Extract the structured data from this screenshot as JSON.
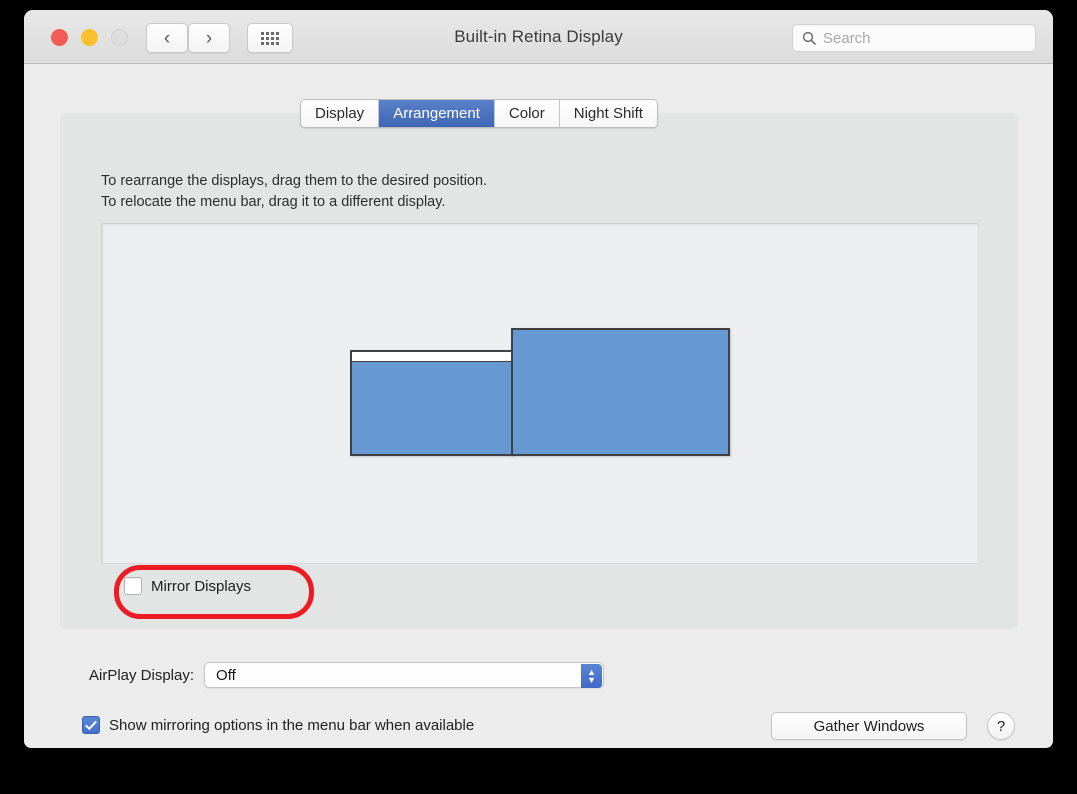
{
  "window": {
    "title": "Built-in Retina Display"
  },
  "toolbar": {
    "back_icon": "chevron-left-icon",
    "forward_icon": "chevron-right-icon",
    "grid_icon": "show-all-grid-icon",
    "search_placeholder": "Search",
    "search_value": ""
  },
  "tabs": [
    {
      "label": "Display",
      "active": false
    },
    {
      "label": "Arrangement",
      "active": true
    },
    {
      "label": "Color",
      "active": false
    },
    {
      "label": "Night Shift",
      "active": false
    }
  ],
  "instructions": {
    "line1": "To rearrange the displays, drag them to the desired position.",
    "line2": "To relocate the menu bar, drag it to a different display."
  },
  "arrangement": {
    "displays": [
      {
        "name": "left-display",
        "has_menu_bar": true
      },
      {
        "name": "right-display",
        "has_menu_bar": false
      }
    ],
    "display_color": "#6699d1",
    "display_border_color": "#3f4145"
  },
  "mirror": {
    "label": "Mirror Displays",
    "checked": false,
    "highlight_color": "#ec1c24"
  },
  "airplay": {
    "label": "AirPlay Display:",
    "value": "Off"
  },
  "footer": {
    "show_mirroring_label": "Show mirroring options in the menu bar when available",
    "show_mirroring_checked": true,
    "gather_windows_label": "Gather Windows",
    "help_label": "?"
  }
}
